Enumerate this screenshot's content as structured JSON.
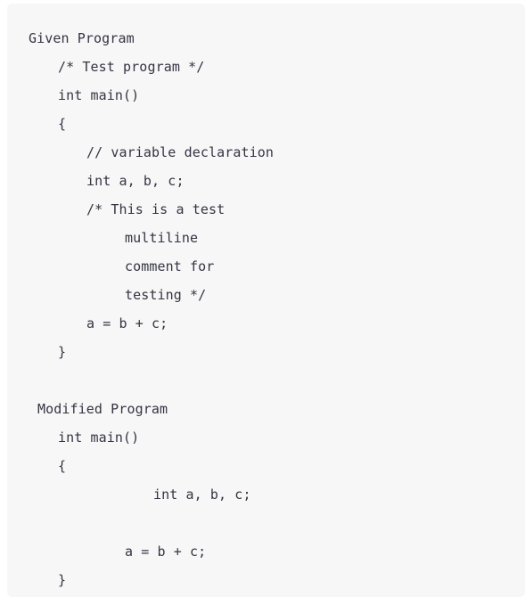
{
  "document": {
    "given_program": {
      "heading": "Given Program",
      "lines": [
        "/* Test program */",
        "int main()",
        "{",
        "// variable declaration",
        "int a, b, c;",
        "/* This is a test",
        "multiline",
        "comment for",
        "testing */",
        "a = b + c;",
        "}"
      ]
    },
    "modified_program": {
      "heading": "Modified Program",
      "lines": [
        "int main()",
        "{",
        "int a, b, c;",
        "a = b + c;",
        "}"
      ]
    }
  }
}
